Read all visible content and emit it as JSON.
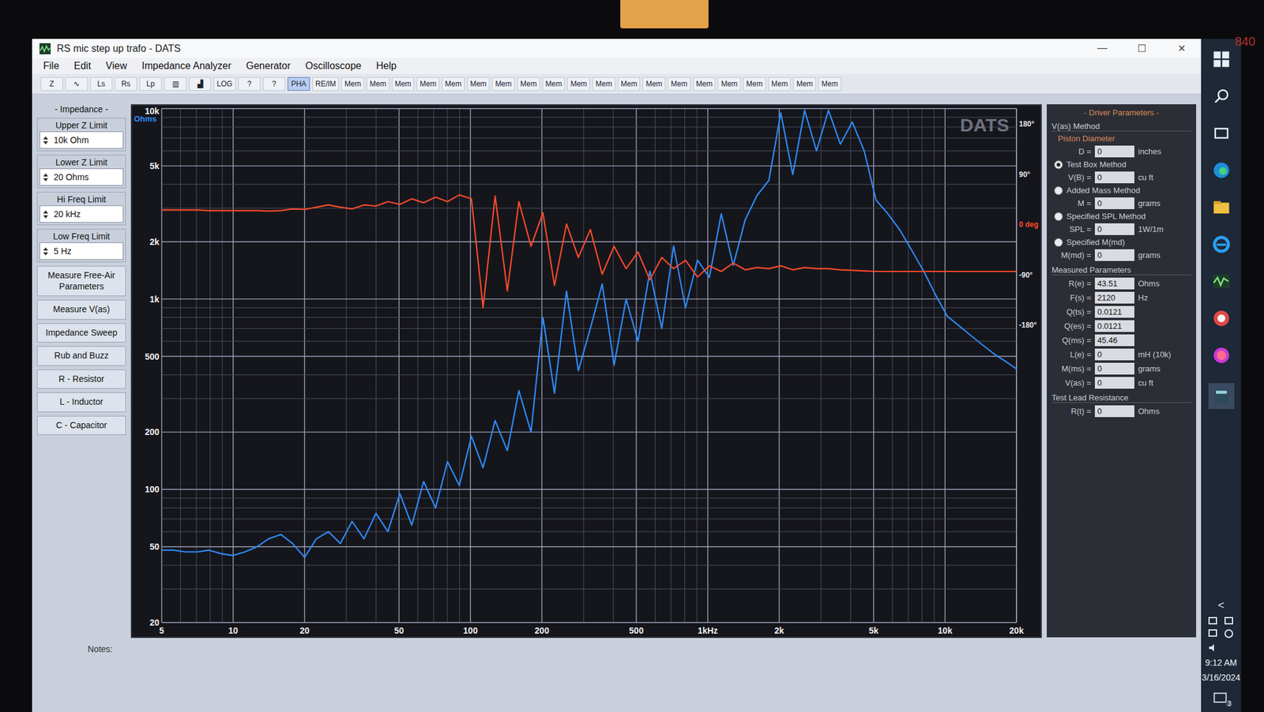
{
  "bezel": {
    "label": "840"
  },
  "window": {
    "title": "RS mic step up trafo - DATS",
    "controls": [
      "—",
      "☐",
      "✕"
    ]
  },
  "menu": [
    "File",
    "Edit",
    "View",
    "Impedance Analyzer",
    "Generator",
    "Oscilloscope",
    "Help"
  ],
  "toolbar": [
    {
      "label": "Z",
      "selected": false
    },
    {
      "label": "∿",
      "selected": false
    },
    {
      "label": "Ls",
      "selected": false
    },
    {
      "label": "Rs",
      "selected": false
    },
    {
      "label": "Lp",
      "selected": false
    },
    {
      "label": "▥",
      "selected": false
    },
    {
      "label": "▟",
      "selected": false
    },
    {
      "label": "LOG",
      "selected": false
    },
    {
      "label": "?",
      "selected": false
    },
    {
      "label": "?",
      "selected": false
    },
    {
      "label": "PHA",
      "selected": true
    },
    {
      "label": "RE/IM",
      "selected": false
    },
    {
      "label": "Mem",
      "selected": false
    },
    {
      "label": "Mem",
      "selected": false
    },
    {
      "label": "Mem",
      "selected": false
    },
    {
      "label": "Mem",
      "selected": false
    },
    {
      "label": "Mem",
      "selected": false
    },
    {
      "label": "Mem",
      "selected": false
    },
    {
      "label": "Mem",
      "selected": false
    },
    {
      "label": "Mem",
      "selected": false
    },
    {
      "label": "Mem",
      "selected": false
    },
    {
      "label": "Mem",
      "selected": false
    },
    {
      "label": "Mem",
      "selected": false
    },
    {
      "label": "Mem",
      "selected": false
    },
    {
      "label": "Mem",
      "selected": false
    },
    {
      "label": "Mem",
      "selected": false
    },
    {
      "label": "Mem",
      "selected": false
    },
    {
      "label": "Mem",
      "selected": false
    },
    {
      "label": "Mem",
      "selected": false
    },
    {
      "label": "Mem",
      "selected": false
    },
    {
      "label": "Mem",
      "selected": false
    },
    {
      "label": "Mem",
      "selected": false
    }
  ],
  "impedance_panel": {
    "title": "- Impedance -",
    "limits": [
      {
        "label": "Upper Z Limit",
        "value": "10k Ohm"
      },
      {
        "label": "Lower Z Limit",
        "value": "20 Ohms"
      },
      {
        "label": "Hi Freq Limit",
        "value": "20 kHz"
      },
      {
        "label": "Low Freq Limit",
        "value": "5 Hz"
      }
    ],
    "buttons": [
      "Measure Free-Air Parameters",
      "Measure V(as)",
      "Impedance Sweep",
      "Rub and Buzz",
      "R - Resistor",
      "L - Inductor",
      "C - Capacitor"
    ]
  },
  "chart": {
    "y_unit": "Ohms",
    "watermark": "DATS",
    "y_ticks": [
      {
        "label": "10k",
        "value": 10000
      },
      {
        "label": "5k",
        "value": 5000
      },
      {
        "label": "2k",
        "value": 2000
      },
      {
        "label": "1k",
        "value": 1000
      },
      {
        "label": "500",
        "value": 500
      },
      {
        "label": "200",
        "value": 200
      },
      {
        "label": "100",
        "value": 100
      },
      {
        "label": "50",
        "value": 50
      },
      {
        "label": "20",
        "value": 20
      }
    ],
    "x_ticks": [
      {
        "label": "5",
        "value": 5
      },
      {
        "label": "10",
        "value": 10
      },
      {
        "label": "20",
        "value": 20
      },
      {
        "label": "50",
        "value": 50
      },
      {
        "label": "100",
        "value": 100
      },
      {
        "label": "200",
        "value": 200
      },
      {
        "label": "500",
        "value": 500
      },
      {
        "label": "1kHz",
        "value": 1000
      },
      {
        "label": "2k",
        "value": 2000
      },
      {
        "label": "5k",
        "value": 5000
      },
      {
        "label": "10k",
        "value": 10000
      },
      {
        "label": "20k",
        "value": 20000
      }
    ],
    "phase_ticks": [
      {
        "label": "180°",
        "value": 180,
        "color": "#e6e6e6"
      },
      {
        "label": "90°",
        "value": 90,
        "color": "#e6e6e6"
      },
      {
        "label": "0 deg",
        "value": 0,
        "color": "#ff4a2a"
      },
      {
        "label": "-90°",
        "value": -90,
        "color": "#e6e6e6"
      },
      {
        "label": "-180°",
        "value": -180,
        "color": "#e6e6e6"
      }
    ],
    "freqs_hz": [
      5,
      5.6,
      6.3,
      7.1,
      7.9,
      8.9,
      10,
      11.2,
      12.6,
      14.1,
      15.9,
      17.8,
      20,
      22.4,
      25.2,
      28.3,
      31.7,
      35.6,
      40,
      44.9,
      50.4,
      56.6,
      63.5,
      71.3,
      80,
      89.8,
      101,
      113,
      127,
      143,
      160,
      180,
      202,
      226,
      254,
      285,
      320,
      359,
      403,
      453,
      508,
      570,
      640,
      718,
      806,
      905,
      1016,
      1140,
      1280,
      1437,
      1613,
      1810,
      2032,
      2281,
      2560,
      2874,
      3225,
      3620,
      4064,
      4561,
      5120,
      5747,
      6451,
      7241,
      8127,
      9123,
      10240,
      11494,
      12902,
      14482,
      16255,
      18246,
      20000
    ],
    "series": [
      {
        "kind": "impedance",
        "color": "#2f8cff",
        "values": [
          48,
          48,
          47,
          47,
          48,
          46,
          45,
          47,
          50,
          55,
          58,
          52,
          44,
          55,
          60,
          52,
          68,
          55,
          75,
          60,
          95,
          65,
          110,
          80,
          140,
          105,
          190,
          130,
          230,
          160,
          330,
          200,
          800,
          320,
          1100,
          420,
          700,
          1200,
          450,
          1000,
          600,
          1400,
          700,
          1900,
          900,
          1600,
          1300,
          2800,
          1500,
          2600,
          3500,
          4200,
          9500,
          4500,
          9800,
          6000,
          9800,
          6500,
          8500,
          6000,
          3300,
          2800,
          2300,
          1800,
          1400,
          1050,
          810,
          720,
          640,
          570,
          510,
          465,
          430
        ]
      },
      {
        "kind": "phase",
        "color": "#ff4a2a",
        "values": [
          25,
          25,
          25,
          25,
          24,
          24,
          24,
          24,
          24,
          23,
          24,
          27,
          26,
          30,
          34,
          30,
          27,
          34,
          32,
          40,
          35,
          45,
          38,
          48,
          40,
          52,
          45,
          -150,
          50,
          -120,
          40,
          -40,
          20,
          -110,
          0,
          -60,
          -10,
          -90,
          -40,
          -80,
          -50,
          -100,
          -60,
          -80,
          -65,
          -95,
          -75,
          -85,
          -70,
          -82,
          -78,
          -80,
          -75,
          -82,
          -78,
          -80,
          -80,
          -82,
          -83,
          -84,
          -85,
          -85,
          -85,
          -85,
          -85,
          -85,
          -85,
          -85,
          -85,
          -85,
          -85,
          -85,
          -85
        ]
      }
    ]
  },
  "driver_parameters": {
    "title": "- Driver Parameters -",
    "method_title": "V(as) Method",
    "piston": {
      "label": "Piston Diameter",
      "field": "D =",
      "value": "0",
      "unit": "inches"
    },
    "methods": [
      {
        "label": "Test Box Method",
        "selected": true,
        "field": "V(B) =",
        "value": "0",
        "unit": "cu ft"
      },
      {
        "label": "Added Mass Method",
        "selected": false,
        "field": "M =",
        "value": "0",
        "unit": "grams"
      },
      {
        "label": "Specified SPL Method",
        "selected": false,
        "field": "SPL =",
        "value": "0",
        "unit": "1W/1m"
      },
      {
        "label": "Specified M(md)",
        "selected": false,
        "field": "M(md) =",
        "value": "0",
        "unit": "grams"
      }
    ],
    "measured_title": "Measured Parameters",
    "measured": [
      {
        "field": "R(e) =",
        "value": "43.51",
        "unit": "Ohms"
      },
      {
        "field": "F(s) =",
        "value": "2120",
        "unit": "Hz"
      },
      {
        "field": "Q(ts) =",
        "value": "0.0121",
        "unit": ""
      },
      {
        "field": "Q(es) =",
        "value": "0.0121",
        "unit": ""
      },
      {
        "field": "Q(ms) =",
        "value": "45.46",
        "unit": ""
      },
      {
        "field": "L(e) =",
        "value": "0",
        "unit": "mH (10k)"
      },
      {
        "field": "M(ms) =",
        "value": "0",
        "unit": "grams"
      },
      {
        "field": "V(as) =",
        "value": "0",
        "unit": "cu ft"
      }
    ],
    "lead_title": "Test Lead Resistance",
    "lead": {
      "field": "R(t) =",
      "value": "0",
      "unit": "Ohms"
    }
  },
  "notes": {
    "label": "Notes:"
  },
  "taskbar": {
    "chevron": "<",
    "time": "9:12 AM",
    "date": "3/16/2024",
    "badge": "3"
  }
}
